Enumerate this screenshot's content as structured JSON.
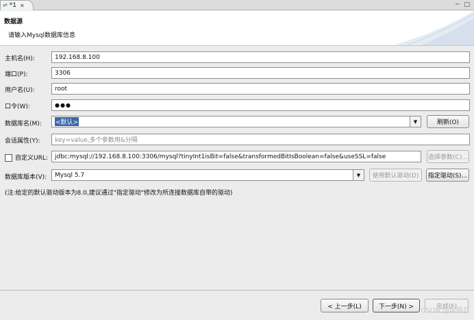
{
  "tab": {
    "label": "*1"
  },
  "header": {
    "title": "数据源",
    "description": "请输入Mysql数据库信息"
  },
  "form": {
    "host": {
      "label": "主机名(H):",
      "value": "192.168.8.100"
    },
    "port": {
      "label": "端口(P):",
      "value": "3306"
    },
    "user": {
      "label": "用户名(U):",
      "value": "root"
    },
    "password": {
      "label": "口令(W):",
      "value": "●●●"
    },
    "database": {
      "label": "数据库名(M):",
      "value": "<默认>"
    },
    "session": {
      "label": "会话属性(Y):",
      "placeholder": "key=value,多个参数用&分隔"
    },
    "custom_url": {
      "label": "自定义URL:",
      "checked": false,
      "value": "jdbc:mysql://192.168.8.100:3306/mysql?tinyInt1isBit=false&transformedBitIsBoolean=false&useSSL=false"
    },
    "db_version": {
      "label": "数据库版本(V):",
      "value": "Mysql 5.7"
    },
    "note": "(注:给定的默认驱动版本为8.0,建议通过\"指定驱动\"修改为所连接数据库自带的驱动)"
  },
  "buttons": {
    "refresh": "刷新(O)",
    "select_params": "选择参数(C)...",
    "use_default_driver": "使用默认驱动(D)",
    "specify_driver": "指定驱动(S)...",
    "back": "< 上一步(L)",
    "next": "下一步(N) >",
    "finish": "完成(F)"
  },
  "watermark": "CSDN @风络豆",
  "colors": {
    "selection": "#3b67a8",
    "header_bg": "#ffffff",
    "body_bg": "#ececec"
  }
}
